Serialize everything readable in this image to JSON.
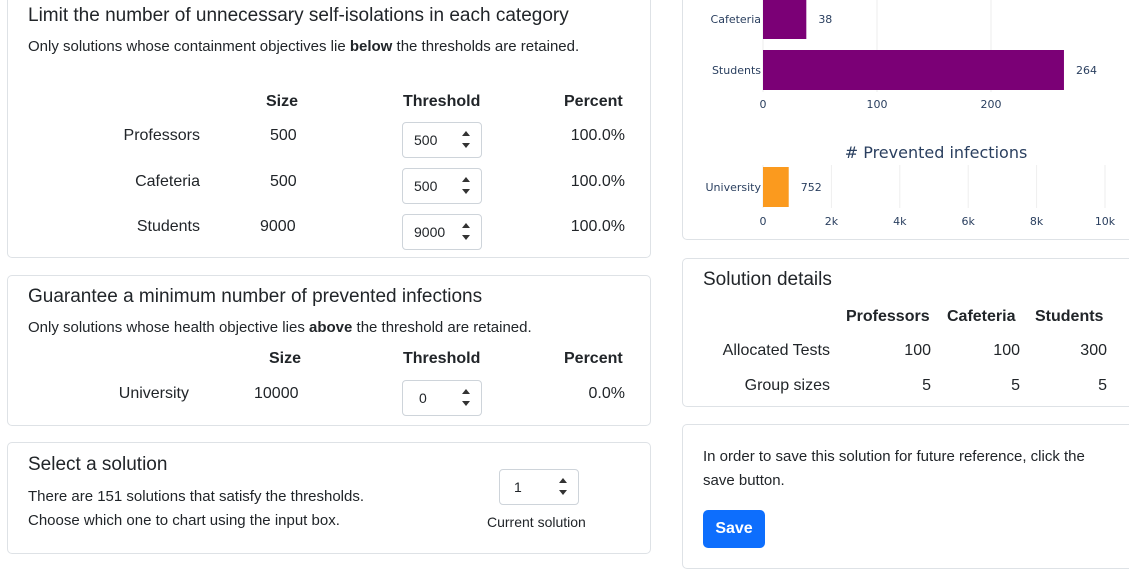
{
  "thresholds_card": {
    "title": "Limit the number of unnecessary self-isolations in each category",
    "desc_pre": "Only solutions whose containment objectives lie ",
    "desc_bold": "below",
    "desc_post": " the thresholds are retained.",
    "headers": {
      "size": "Size",
      "threshold": "Threshold",
      "percent": "Percent"
    },
    "rows": [
      {
        "label": "Professors",
        "size": "500",
        "threshold": "500",
        "percent": "100.0%"
      },
      {
        "label": "Cafeteria",
        "size": "500",
        "threshold": "500",
        "percent": "100.0%"
      },
      {
        "label": "Students",
        "size": "9000",
        "threshold": "9000",
        "percent": "100.0%"
      }
    ]
  },
  "infections_card": {
    "title": "Guarantee a minimum number of prevented infections",
    "desc_pre": "Only solutions whose health objective lies ",
    "desc_bold": "above",
    "desc_post": " the threshold are retained.",
    "headers": {
      "size": "Size",
      "threshold": "Threshold",
      "percent": "Percent"
    },
    "row": {
      "label": "University",
      "size": "10000",
      "threshold": "0",
      "percent": "0.0%"
    }
  },
  "select_card": {
    "title": "Select a solution",
    "line1": "There are 151 solutions that satisfy the thresholds.",
    "line2": "Choose which one to chart using the input box.",
    "solution_value": "1",
    "solution_caption": "Current solution"
  },
  "charts": {
    "purple_color": "#7b0076",
    "orange_color": "#fb9a1e",
    "isolation_chart": {
      "type": "bar",
      "orientation": "horizontal",
      "categories": [
        "Cafeteria",
        "Students"
      ],
      "values": [
        38,
        264
      ],
      "value_labels": [
        "38",
        "264"
      ],
      "xlim": [
        0,
        300
      ],
      "xticks": [
        0,
        100,
        200
      ],
      "xtick_labels": [
        "0",
        "100",
        "200"
      ]
    },
    "infections_chart": {
      "type": "bar",
      "orientation": "horizontal",
      "title": "# Prevented infections",
      "categories": [
        "University"
      ],
      "values": [
        752
      ],
      "value_labels": [
        "752"
      ],
      "xlim": [
        0,
        10000
      ],
      "xticks": [
        0,
        2000,
        4000,
        6000,
        8000,
        10000
      ],
      "xtick_labels": [
        "0",
        "2k",
        "4k",
        "6k",
        "8k",
        "10k"
      ]
    }
  },
  "chart_data": [
    {
      "type": "bar",
      "categories": [
        "Cafeteria",
        "Students"
      ],
      "values": [
        38,
        264
      ],
      "xlim": [
        0,
        300
      ],
      "grid": true
    },
    {
      "type": "bar",
      "title": "# Prevented infections",
      "categories": [
        "University"
      ],
      "values": [
        752
      ],
      "xlim": [
        0,
        10000
      ],
      "grid": true
    }
  ],
  "details_card": {
    "title": "Solution details",
    "columns": [
      "Professors",
      "Cafeteria",
      "Students"
    ],
    "rows": [
      {
        "label": "Allocated Tests",
        "values": [
          "100",
          "100",
          "300"
        ]
      },
      {
        "label": "Group sizes",
        "values": [
          "5",
          "5",
          "5"
        ]
      }
    ]
  },
  "save_card": {
    "text": "In order to save this solution for future reference, click the save button.",
    "button_label": "Save"
  }
}
